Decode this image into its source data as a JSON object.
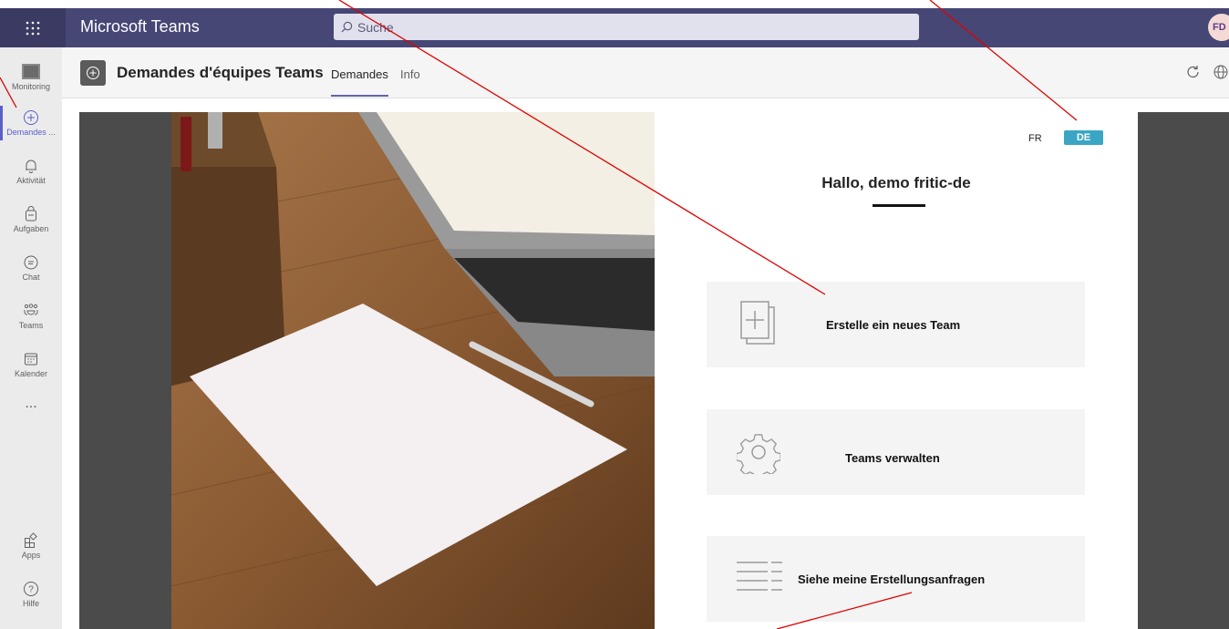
{
  "topbar": {
    "app_title": "Microsoft Teams",
    "search_placeholder": "Suche",
    "avatar_initials": "FD"
  },
  "rail": {
    "items": [
      {
        "label": "Monitoring",
        "icon": "monitoring-icon"
      },
      {
        "label": "Demandes ...",
        "icon": "plus-circle-icon"
      },
      {
        "label": "Aktivität",
        "icon": "bell-icon"
      },
      {
        "label": "Aufgaben",
        "icon": "tasks-icon"
      },
      {
        "label": "Chat",
        "icon": "chat-icon"
      },
      {
        "label": "Teams",
        "icon": "teams-icon"
      },
      {
        "label": "Kalender",
        "icon": "calendar-icon"
      },
      {
        "label": "...",
        "icon": "more-icon"
      },
      {
        "label": "Apps",
        "icon": "apps-icon"
      },
      {
        "label": "Hilfe",
        "icon": "help-icon"
      }
    ]
  },
  "app_header": {
    "title": "Demandes d'équipes Teams",
    "tabs": [
      {
        "label": "Demandes",
        "active": true
      },
      {
        "label": "Info",
        "active": false
      }
    ]
  },
  "panel": {
    "languages": [
      "FR",
      "DE"
    ],
    "active_language": "DE",
    "greeting": "Hallo, demo fritic-de",
    "cards": [
      {
        "label": "Erstelle ein neues Team",
        "icon": "new-team-icon"
      },
      {
        "label": "Teams verwalten",
        "icon": "gear-icon"
      },
      {
        "label": "Siehe meine Erstellungsanfragen",
        "icon": "list-icon"
      }
    ]
  },
  "colors": {
    "topbar": "#464775",
    "accent": "#6264a7",
    "lang_active": "#3aa6c4",
    "annotation": "#e00000"
  }
}
